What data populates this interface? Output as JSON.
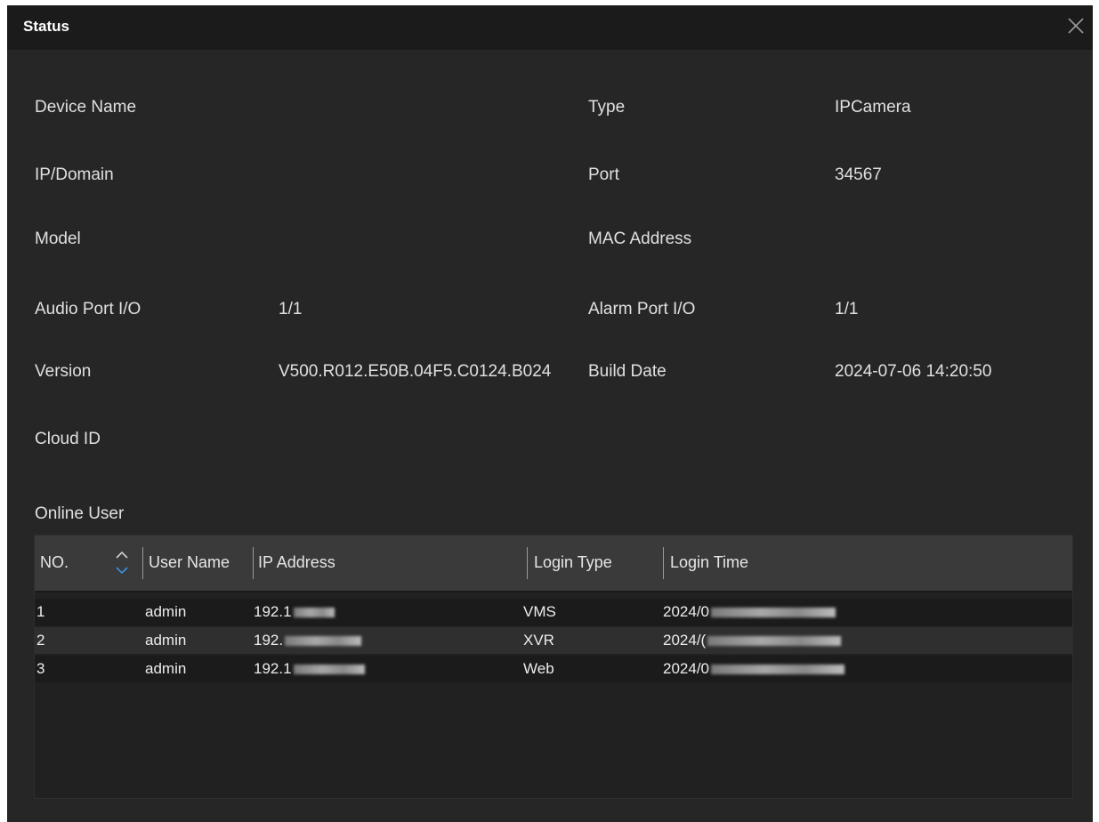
{
  "dialog": {
    "title": "Status",
    "close_icon": "close-icon"
  },
  "info": {
    "device_name_label": "Device Name",
    "device_name_value": "",
    "type_label": "Type",
    "type_value": "IPCamera",
    "ip_domain_label": "IP/Domain",
    "ip_domain_value": "",
    "port_label": "Port",
    "port_value": "34567",
    "model_label": "Model",
    "model_value": "",
    "mac_label": "MAC Address",
    "mac_value": "",
    "audio_port_label": "Audio Port I/O",
    "audio_port_value": "1/1",
    "alarm_port_label": "Alarm Port I/O",
    "alarm_port_value": "1/1",
    "version_label": "Version",
    "version_value": "V500.R012.E50B.04F5.C0124.B024",
    "build_date_label": "Build Date",
    "build_date_value": "2024-07-06 14:20:50",
    "cloud_id_label": "Cloud ID",
    "cloud_id_value": ""
  },
  "online_user": {
    "label": "Online User",
    "columns": {
      "no": "NO.",
      "user_name": "User Name",
      "ip_address": "IP Address",
      "login_type": "Login Type",
      "login_time": "Login Time"
    },
    "sort_icon": "sort-up-down-icon",
    "rows": [
      {
        "no": "1",
        "user": "admin",
        "ip": "192.1",
        "type": "VMS",
        "time": "2024/0"
      },
      {
        "no": "2",
        "user": "admin",
        "ip": "192.",
        "type": "XVR",
        "time": "2024/("
      },
      {
        "no": "3",
        "user": "admin",
        "ip": "192.1",
        "type": "Web",
        "time": "2024/0"
      }
    ]
  }
}
